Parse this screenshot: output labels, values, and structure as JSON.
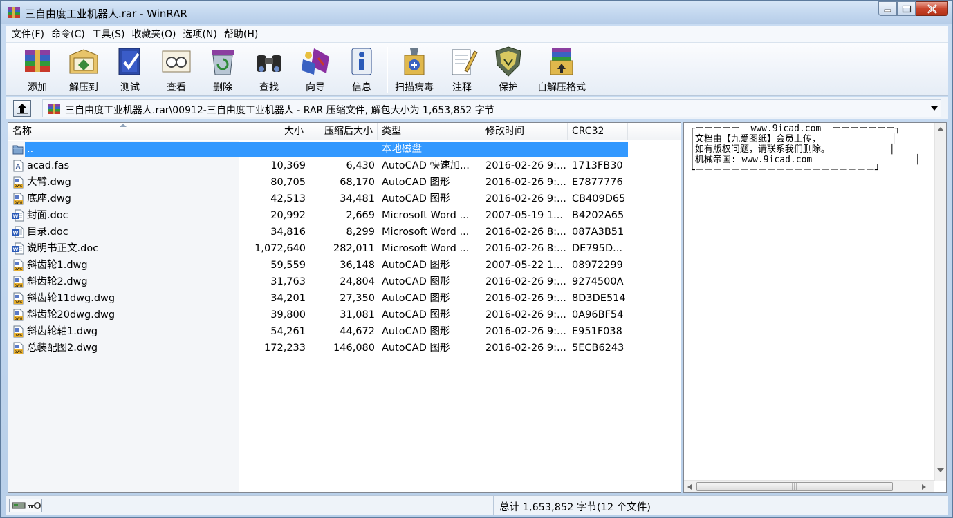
{
  "window": {
    "title": "三自由度工业机器人.rar - WinRAR",
    "controls": [
      "minimize",
      "maximize",
      "close"
    ]
  },
  "menu": [
    {
      "label": "文件(F)"
    },
    {
      "label": "命令(C)"
    },
    {
      "label": "工具(S)"
    },
    {
      "label": "收藏夹(O)"
    },
    {
      "label": "选项(N)"
    },
    {
      "label": "帮助(H)"
    }
  ],
  "toolbar": [
    {
      "label": "添加",
      "icon": "add-archive-icon"
    },
    {
      "label": "解压到",
      "icon": "extract-to-icon"
    },
    {
      "label": "测试",
      "icon": "test-icon"
    },
    {
      "label": "查看",
      "icon": "view-icon"
    },
    {
      "label": "删除",
      "icon": "delete-icon"
    },
    {
      "label": "查找",
      "icon": "find-icon"
    },
    {
      "label": "向导",
      "icon": "wizard-icon"
    },
    {
      "label": "信息",
      "icon": "info-icon"
    },
    {
      "label": "扫描病毒",
      "icon": "virus-scan-icon"
    },
    {
      "label": "注释",
      "icon": "comment-icon"
    },
    {
      "label": "保护",
      "icon": "protect-icon"
    },
    {
      "label": "自解压格式",
      "icon": "sfx-icon"
    }
  ],
  "address": {
    "path": "三自由度工业机器人.rar\\00912-三自由度工业机器人 - RAR 压缩文件, 解包大小为 1,653,852 字节"
  },
  "columns": {
    "name": "名称",
    "size": "大小",
    "packed": "压缩后大小",
    "type": "类型",
    "modified": "修改时间",
    "crc": "CRC32"
  },
  "files": [
    {
      "name": "..",
      "size": "",
      "packed": "",
      "type": "本地磁盘",
      "modified": "",
      "crc": "",
      "icon": "folder-up-icon",
      "selected": true
    },
    {
      "name": "acad.fas",
      "size": "10,369",
      "packed": "6,430",
      "type": "AutoCAD 快速加...",
      "modified": "2016-02-26 9:...",
      "crc": "1713FB30",
      "icon": "fas-file-icon"
    },
    {
      "name": "大臂.dwg",
      "size": "80,705",
      "packed": "68,170",
      "type": "AutoCAD 图形",
      "modified": "2016-02-26 9:...",
      "crc": "E7877776",
      "icon": "dwg-file-icon"
    },
    {
      "name": "底座.dwg",
      "size": "42,513",
      "packed": "34,481",
      "type": "AutoCAD 图形",
      "modified": "2016-02-26 9:...",
      "crc": "CB409D65",
      "icon": "dwg-file-icon"
    },
    {
      "name": "封面.doc",
      "size": "20,992",
      "packed": "2,669",
      "type": "Microsoft Word ...",
      "modified": "2007-05-19 1...",
      "crc": "B4202A65",
      "icon": "doc-file-icon"
    },
    {
      "name": "目录.doc",
      "size": "34,816",
      "packed": "8,299",
      "type": "Microsoft Word ...",
      "modified": "2016-02-26 8:...",
      "crc": "087A3B51",
      "icon": "doc-file-icon"
    },
    {
      "name": "说明书正文.doc",
      "size": "1,072,640",
      "packed": "282,011",
      "type": "Microsoft Word ...",
      "modified": "2016-02-26 8:...",
      "crc": "DE795D...",
      "icon": "doc-file-icon"
    },
    {
      "name": "斜齿轮1.dwg",
      "size": "59,559",
      "packed": "36,148",
      "type": "AutoCAD 图形",
      "modified": "2007-05-22 1...",
      "crc": "08972299",
      "icon": "dwg-file-icon"
    },
    {
      "name": "斜齿轮2.dwg",
      "size": "31,763",
      "packed": "24,804",
      "type": "AutoCAD 图形",
      "modified": "2016-02-26 9:...",
      "crc": "9274500A",
      "icon": "dwg-file-icon"
    },
    {
      "name": "斜齿轮11dwg.dwg",
      "size": "34,201",
      "packed": "27,350",
      "type": "AutoCAD 图形",
      "modified": "2016-02-26 9:...",
      "crc": "8D3DE514",
      "icon": "dwg-file-icon"
    },
    {
      "name": "斜齿轮20dwg.dwg",
      "size": "39,800",
      "packed": "31,081",
      "type": "AutoCAD 图形",
      "modified": "2016-02-26 9:...",
      "crc": "0A96BF54",
      "icon": "dwg-file-icon"
    },
    {
      "name": "斜齿轮轴1.dwg",
      "size": "54,261",
      "packed": "44,672",
      "type": "AutoCAD 图形",
      "modified": "2016-02-26 9:...",
      "crc": "E951F038",
      "icon": "dwg-file-icon"
    },
    {
      "name": "总装配图2.dwg",
      "size": "172,233",
      "packed": "146,080",
      "type": "AutoCAD 图形",
      "modified": "2016-02-26 9:...",
      "crc": "5ECB6243",
      "icon": "dwg-file-icon"
    }
  ],
  "comment": {
    "lines": [
      "┌ーーーーー  www.9icad.com  ーーーーーーー┐",
      "│文档由【九爱图纸】会员上传，             │",
      "│如有版权问题，请联系我们删除。           │",
      "│机械帝国: www.9icad.com                   │",
      "└ーーーーーーーーーーーーーーーーーーーー┘"
    ]
  },
  "status": {
    "summary": "总计 1,653,852 字节(12 个文件)"
  },
  "colors": {
    "selection": "#3399ff",
    "window_frame": "#c1d6ee"
  }
}
